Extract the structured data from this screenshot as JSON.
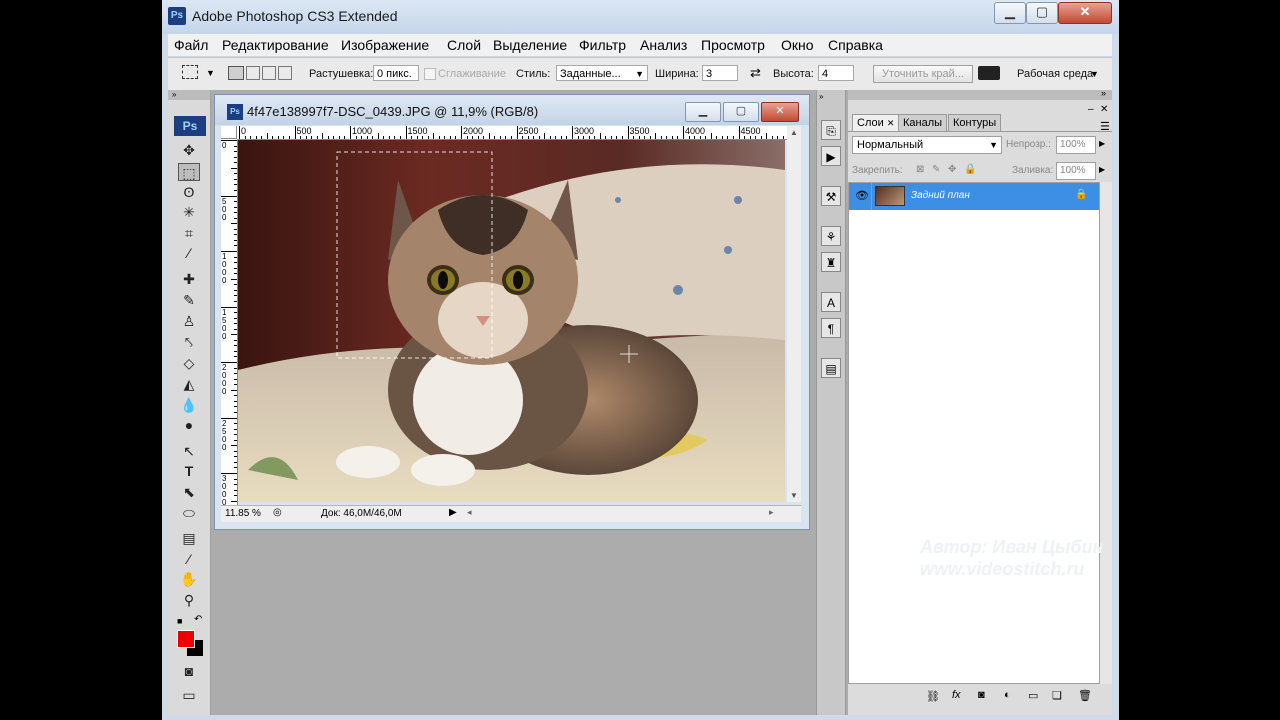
{
  "app": {
    "title": "Adobe Photoshop CS3 Extended",
    "icon_text": "Ps",
    "window_buttons": {
      "minimize": "▁",
      "maximize": "▢",
      "close": "✕"
    }
  },
  "menu": [
    {
      "label": "Файл"
    },
    {
      "label": "Редактирование"
    },
    {
      "label": "Изображение"
    },
    {
      "label": "Слой"
    },
    {
      "label": "Выделение"
    },
    {
      "label": "Фильтр"
    },
    {
      "label": "Анализ"
    },
    {
      "label": "Просмотр"
    },
    {
      "label": "Окно"
    },
    {
      "label": "Справка"
    }
  ],
  "options": {
    "feather_label": "Растушевка:",
    "feather_value": "0 пикс.",
    "antialias_label": "Сглаживание",
    "style_label": "Стиль:",
    "style_value": "Заданные...",
    "width_label": "Ширина:",
    "width_value": "3",
    "height_label": "Высота:",
    "height_value": "4",
    "refine_button": "Уточнить край...",
    "workspace_label": "Рабочая среда"
  },
  "toolbox": {
    "logo": "Ps",
    "foreground_color": "#ee0000",
    "background_color": "#000000"
  },
  "document": {
    "title": "4f47e138997f7-DSC_0439.JPG @ 11,9% (RGB/8)",
    "ruler_top": [
      "0",
      "500",
      "1000",
      "1500",
      "2000",
      "2500",
      "3000",
      "3500",
      "4000",
      "4500"
    ],
    "ruler_left": [
      "0",
      "500",
      "1000",
      "1500",
      "2000",
      "2500",
      "3000"
    ],
    "zoom": "11.85 %",
    "doc_size": "Док: 46,0M/46,0M"
  },
  "layers_panel": {
    "tabs": [
      {
        "label": "Слои"
      },
      {
        "label": "Каналы"
      },
      {
        "label": "Контуры"
      }
    ],
    "blend_mode": "Нормальный",
    "opacity_label": "Непрозр.:",
    "opacity_value": "100%",
    "lock_label": "Закрепить:",
    "fill_label": "Заливка:",
    "fill_value": "100%",
    "layers": [
      {
        "name": "Задний план",
        "selected": true
      }
    ],
    "selection_color": "#3d8fe6"
  },
  "watermark": {
    "line1": "Автор: Иван Цыбин",
    "line2": "www.videostitch.ru"
  }
}
